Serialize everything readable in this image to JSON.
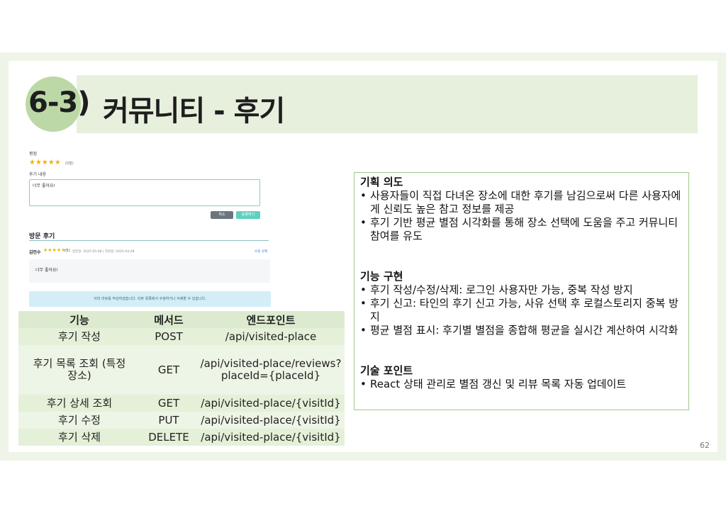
{
  "title": {
    "number": "6-3)",
    "text": "커뮤니티 - 후기"
  },
  "review_form": {
    "rating_label": "평점",
    "stars": "★★★★★",
    "stars_count": "(5점)",
    "content_label": "후기 내용",
    "content_value": "너무 좋아요!",
    "cancel_label": "취소",
    "submit_label": "등록하기"
  },
  "visit_reviews": {
    "title": "방문 후기",
    "reviewer": "김민수",
    "stars": "★★★★★",
    "stars_count": "(5)",
    "meta": "방문일: 2025-05-08 | 작성일: 2025-04-28",
    "actions": "수정 삭제",
    "body": "너무 좋아요!",
    "notice": "이미 리뷰를 작성하셨습니다. 리뷰 목록에서 수정하거나 삭제할 수 있습니다."
  },
  "api_table": {
    "headers": [
      "기능",
      "메서드",
      "엔드포인트"
    ],
    "rows": [
      [
        "후기 작성",
        "POST",
        "/api/visited-place"
      ],
      [
        "후기 목록 조회 (특정 장소)",
        "GET",
        "/api/visited-place/reviews?placeId={placeId}"
      ],
      [
        "후기 상세 조회",
        "GET",
        "/api/visited-place/{visitId}"
      ],
      [
        "후기 수정",
        "PUT",
        "/api/visited-place/{visitId}"
      ],
      [
        "후기 삭제",
        "DELETE",
        "/api/visited-place/{visitId}"
      ]
    ]
  },
  "info": {
    "plan_title": "기획 의도",
    "plan_items": [
      "사용자들이 직접 다녀온 장소에 대한 후기를 남김으로써 다른 사용자에게 신뢰도 높은 참고 정보를 제공",
      "후기 기반 평균 별점 시각화를 통해 장소 선택에 도움을 주고 커뮤니티 참여를 유도"
    ],
    "impl_title": "기능  구현",
    "impl_items": [
      "후기 작성/수정/삭제: 로그인 사용자만 가능, 중복 작성 방지",
      "후기 신고: 타인의 후기 신고 가능, 사유 선택 후 로컬스토리지 중복 방지",
      "평균 별점 표시: 후기별 별점을 종합해 평균을 실시간 계산하여 시각화"
    ],
    "tech_title": "기술 포인트",
    "tech_items": [
      "React 상태 관리로 별점 갱신 및 리뷰 목록 자동 업데이트"
    ]
  },
  "page_number": "62"
}
